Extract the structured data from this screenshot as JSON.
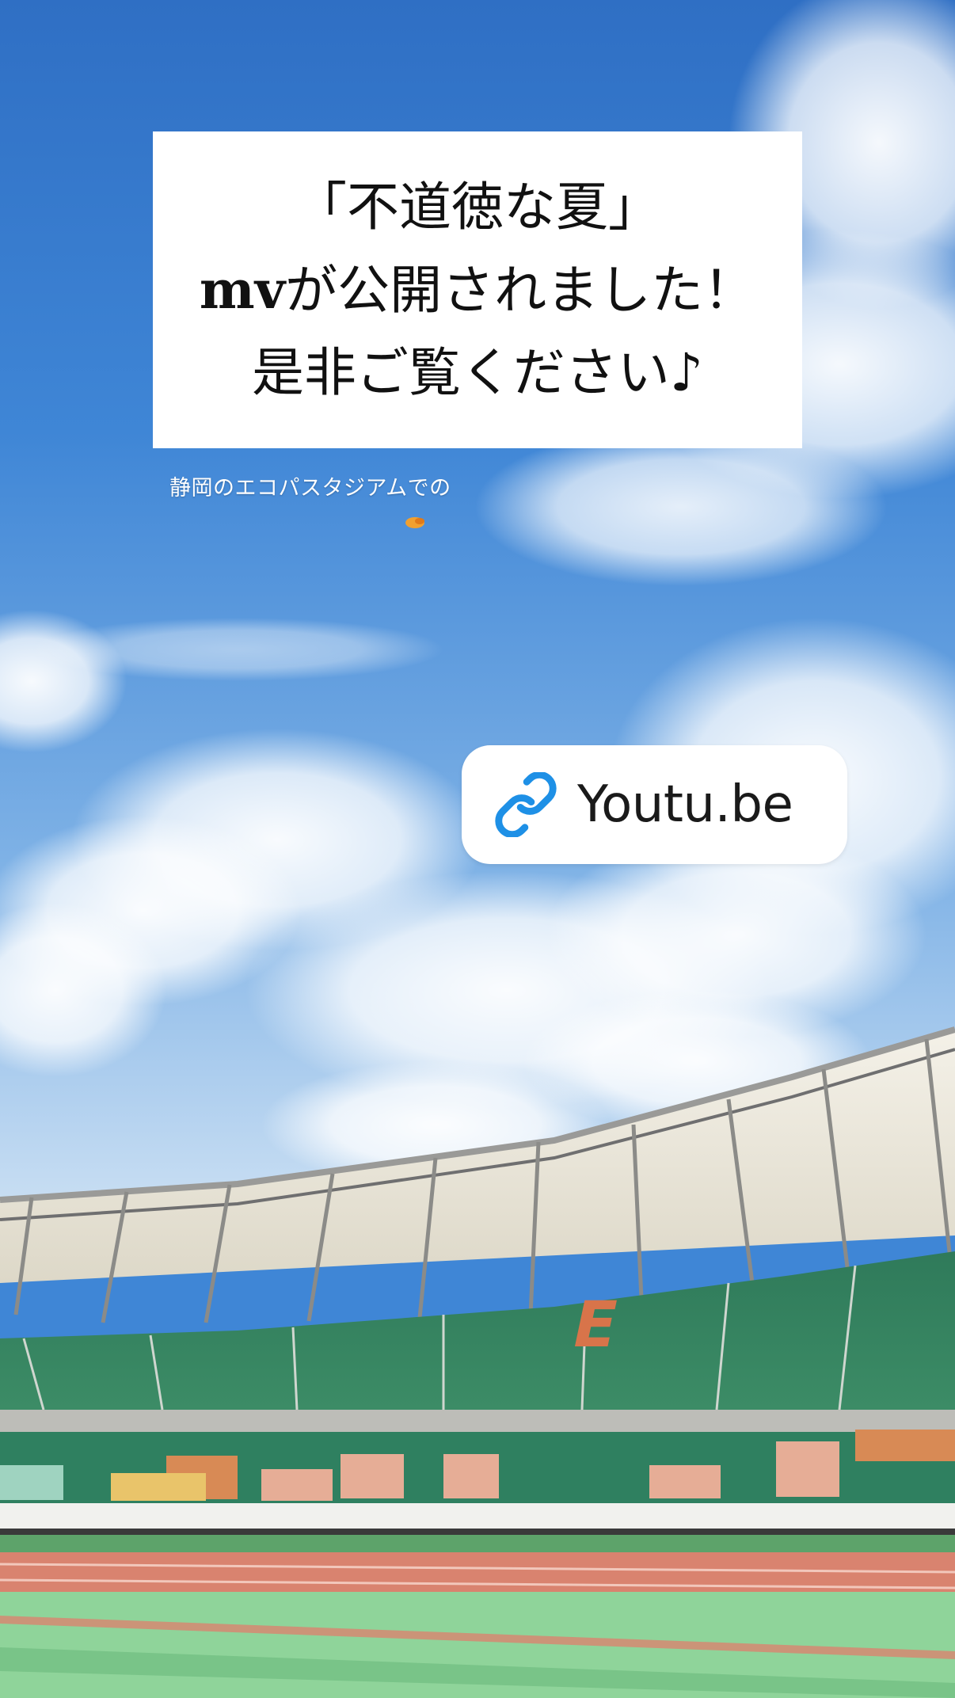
{
  "caption": {
    "line1": "「不道徳な夏」",
    "line2_latin": "mv",
    "line2_rest": "が公開されました！",
    "line3": "是非ご覧ください♪"
  },
  "subtitle": "静岡のエコパスタジアムでの",
  "link_sticker": {
    "label": "Youtu.be",
    "icon": "link-icon"
  },
  "colors": {
    "sky": "#3f86d6",
    "card_background": "#ffffff",
    "link_icon": "#1e90e6",
    "stadium_seats": "#2f7a5a",
    "track": "#d9836f",
    "field": "#7fcf8e"
  }
}
